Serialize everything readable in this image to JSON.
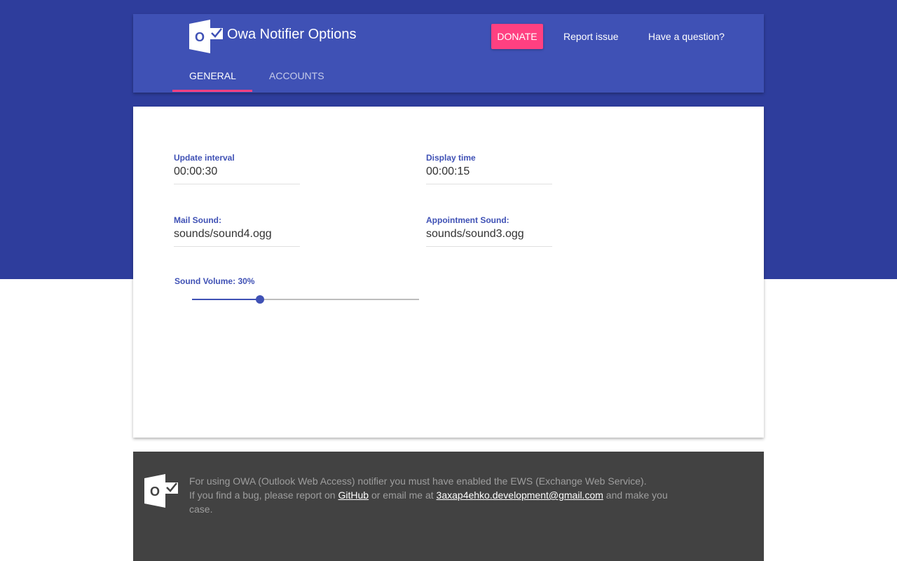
{
  "colors": {
    "primary": "#3f51b5",
    "primary_dark": "#2e3d9c",
    "accent": "#ff4081",
    "footer_bg": "#424242"
  },
  "header": {
    "logo_icon": "outlook-icon",
    "title": "Owa Notifier Options",
    "donate_label": "DONATE",
    "report_issue_label": "Report issue",
    "question_label": "Have a question?",
    "tabs": [
      {
        "label": "GENERAL",
        "active": true
      },
      {
        "label": "ACCOUNTS",
        "active": false
      }
    ]
  },
  "general": {
    "update_interval": {
      "label": "Update interval",
      "value": "00:00:30"
    },
    "display_time": {
      "label": "Display time",
      "value": "00:00:15"
    },
    "mail_sound": {
      "label": "Mail Sound:",
      "value": "sounds/sound4.ogg"
    },
    "appointment_sound": {
      "label": "Appointment Sound:",
      "value": "sounds/sound3.ogg"
    },
    "sound_volume": {
      "label": "Sound Volume: 30%",
      "value": 30,
      "min": 0,
      "max": 100
    }
  },
  "footer": {
    "logo_icon": "outlook-icon",
    "line1": "For using OWA (Outlook Web Access) notifier you must have enabled the EWS (Exchange Web Service).",
    "line2_prefix": "If you find a bug, please report on",
    "github_label": "GitHub",
    "line2_middle": "or email me at",
    "email": "3axap4ehko.development@gmail.com",
    "line2_suffix": "and make you case."
  }
}
